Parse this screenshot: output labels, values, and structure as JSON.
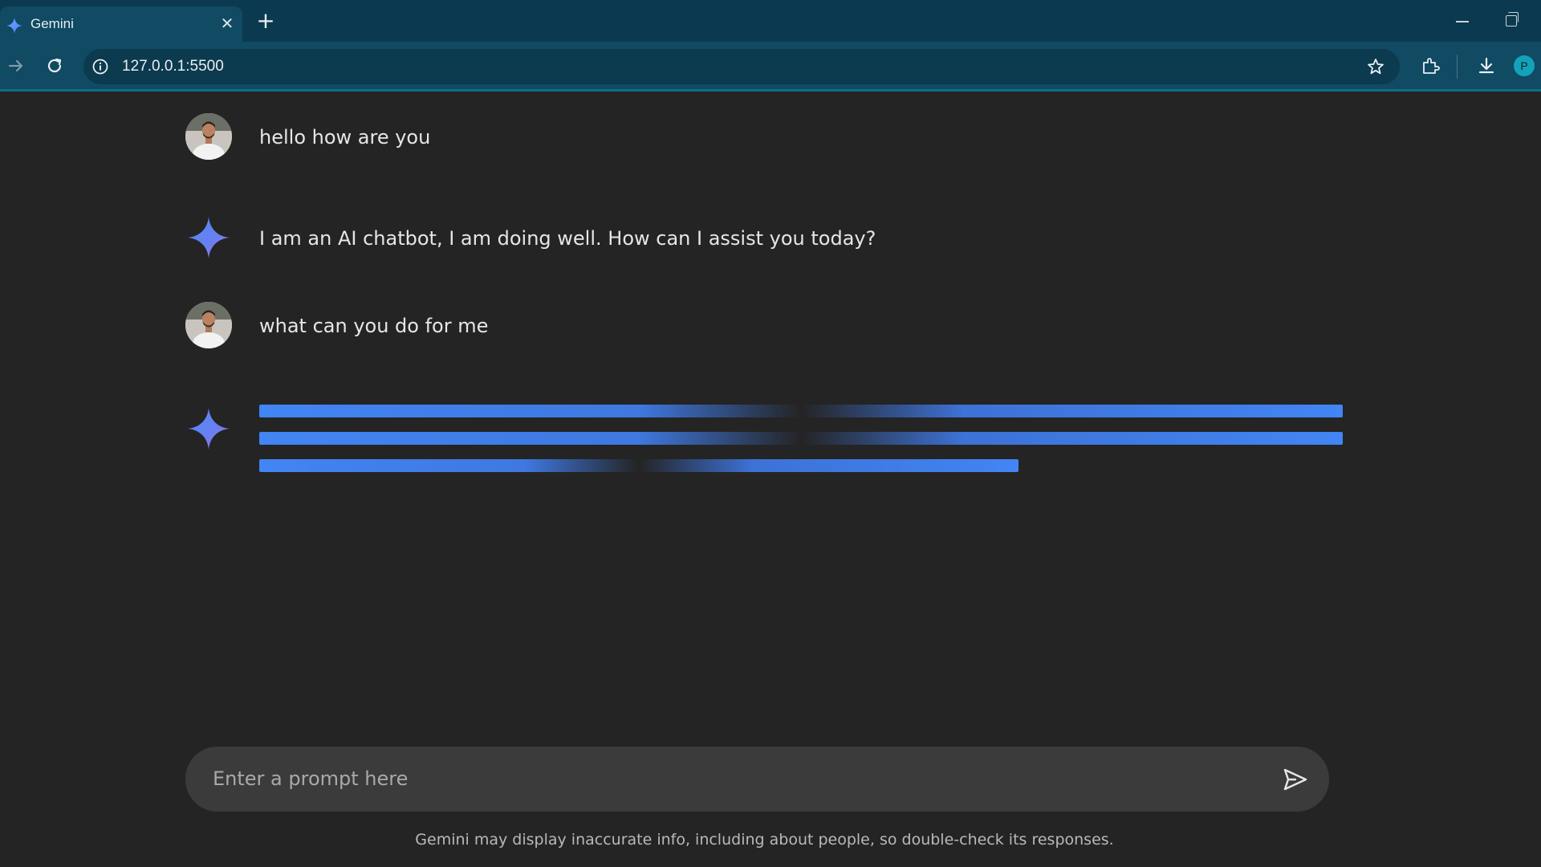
{
  "browser": {
    "tab_title": "Gemini",
    "url": "127.0.0.1:5500",
    "profile_initial": "P"
  },
  "chat": {
    "messages": [
      {
        "role": "user",
        "text": "hello how are you"
      },
      {
        "role": "assistant",
        "text": "I am an AI chatbot, I am doing well. How can I assist you today?"
      },
      {
        "role": "user",
        "text": "what can you do for me"
      },
      {
        "role": "assistant",
        "loading": true
      }
    ]
  },
  "composer": {
    "placeholder": "Enter a prompt here",
    "value": ""
  },
  "disclaimer": "Gemini may display inaccurate info, including about people, so double-check its responses.",
  "colors": {
    "page_bg": "#242424",
    "composer_bg": "#3b3b3b",
    "accent_blue": "#4285f4",
    "chrome_tab": "#104a63",
    "chrome_strip": "#0b3a50"
  }
}
